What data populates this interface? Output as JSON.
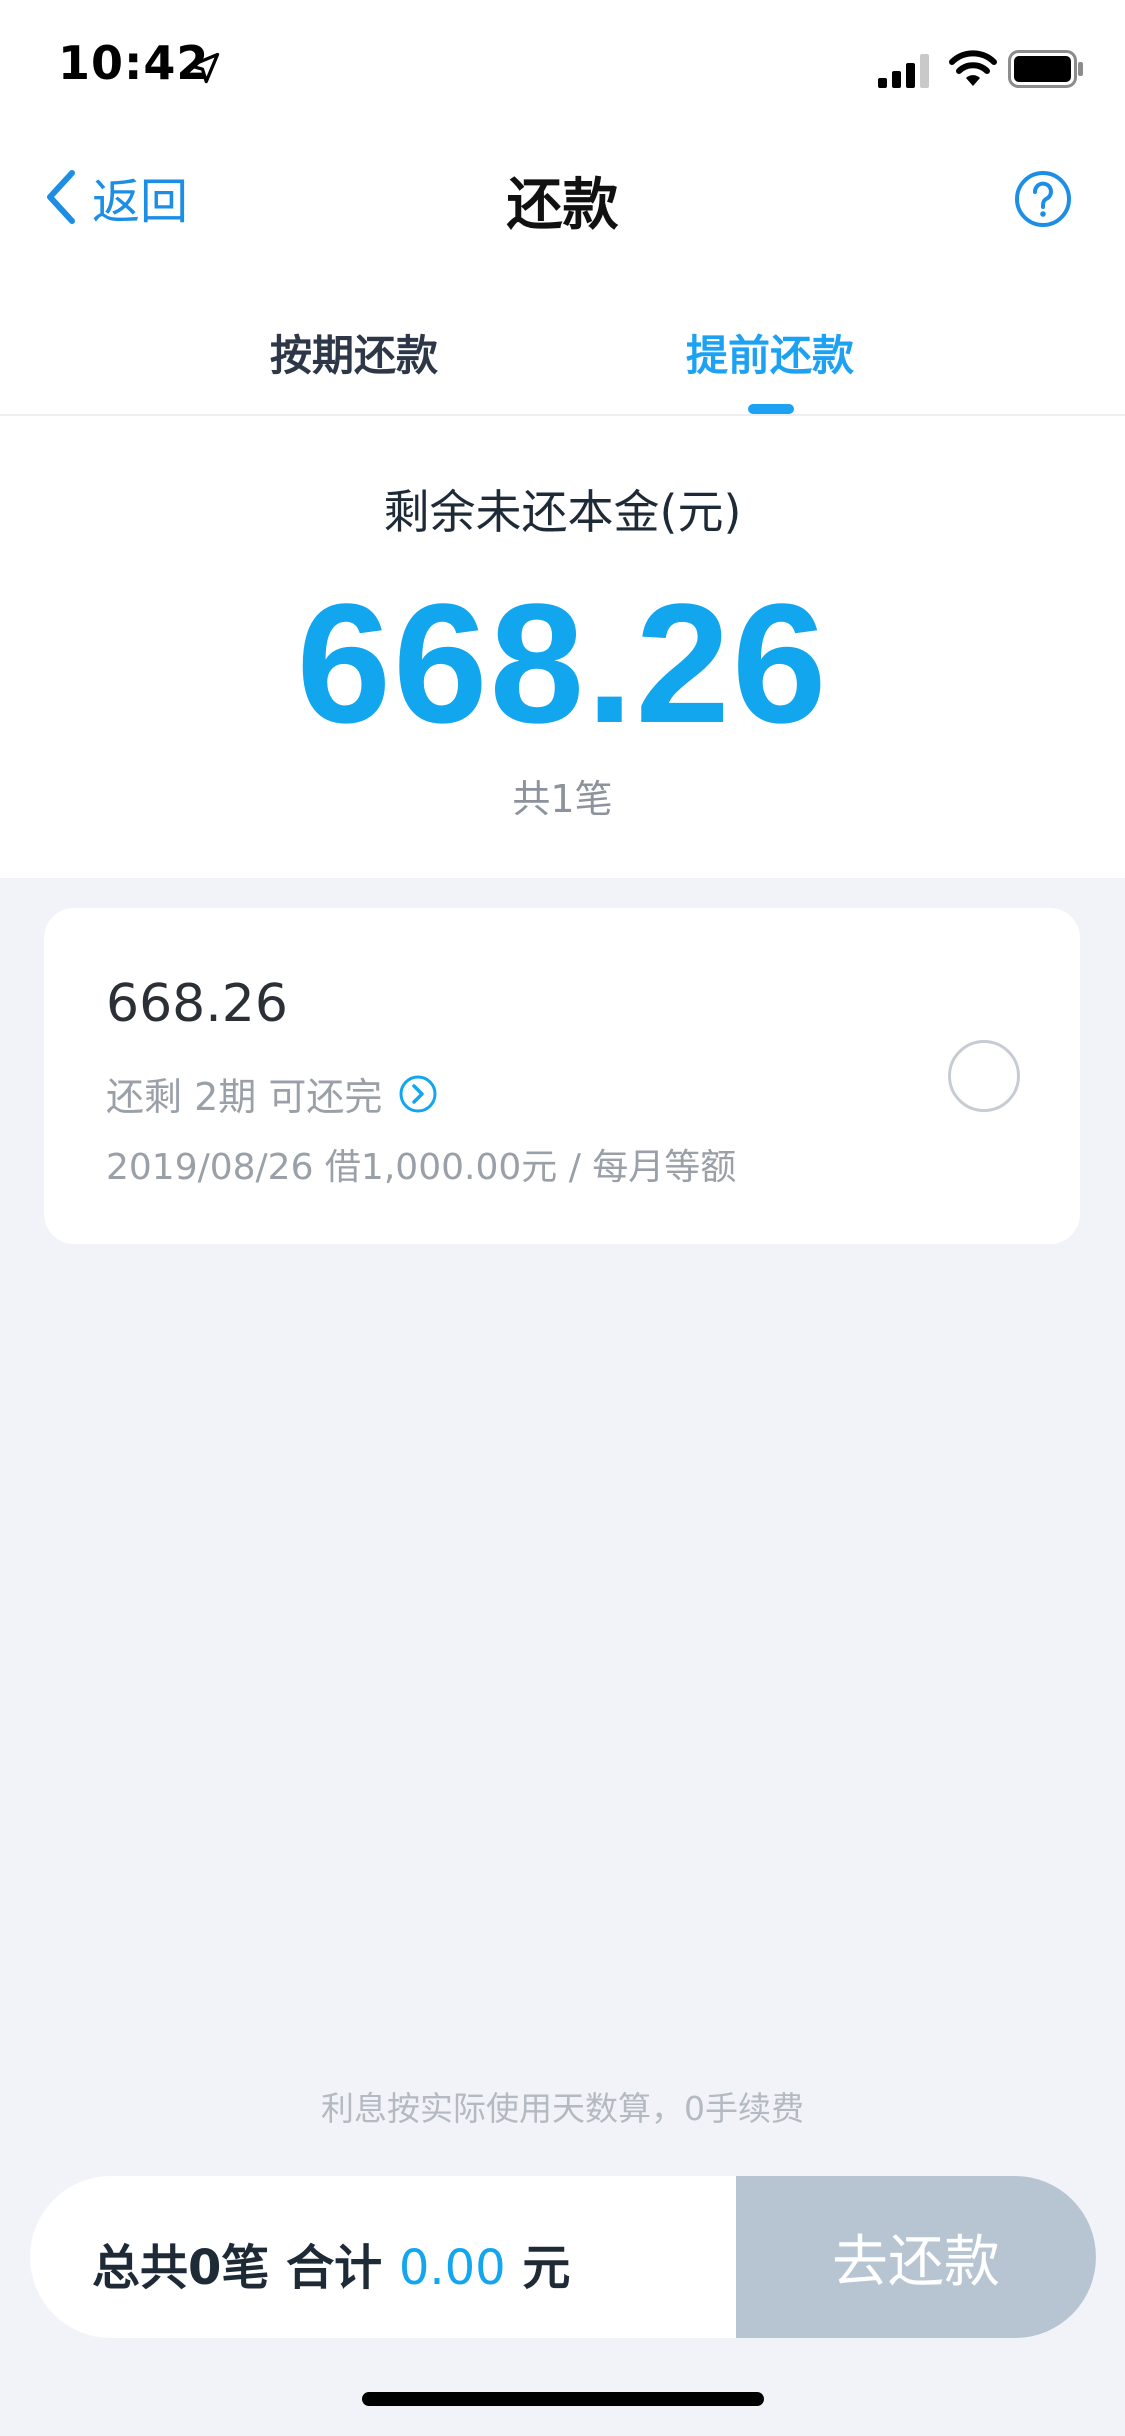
{
  "status_bar": {
    "time": "10:42",
    "icons": [
      "location-arrow-icon",
      "cellular-signal-icon",
      "wifi-icon",
      "battery-icon"
    ]
  },
  "nav": {
    "back_label": "返回",
    "title": "还款",
    "help_icon": "question-circle-icon"
  },
  "tabs": [
    {
      "label": "按期还款",
      "active": false
    },
    {
      "label": "提前还款",
      "active": true
    }
  ],
  "summary": {
    "label": "剩余未还本金(元)",
    "amount": "668.26",
    "count": "共1笔"
  },
  "loans": [
    {
      "amount": "668.26",
      "remaining": "还剩 2期 可还完",
      "meta": "2019/08/26 借1,000.00元 / 每月等额",
      "selected": false
    }
  ],
  "footnote": "利息按实际使用天数算，0手续费",
  "footer": {
    "total_prefix": "总共0笔 合计 ",
    "total_value": "0.00",
    "total_unit": " 元",
    "pay_button": "去还款"
  },
  "colors": {
    "accent": "#12a6ef",
    "link": "#1d8ee6",
    "disabled_button": "#b7c5d3",
    "background": "#f2f3f8"
  }
}
